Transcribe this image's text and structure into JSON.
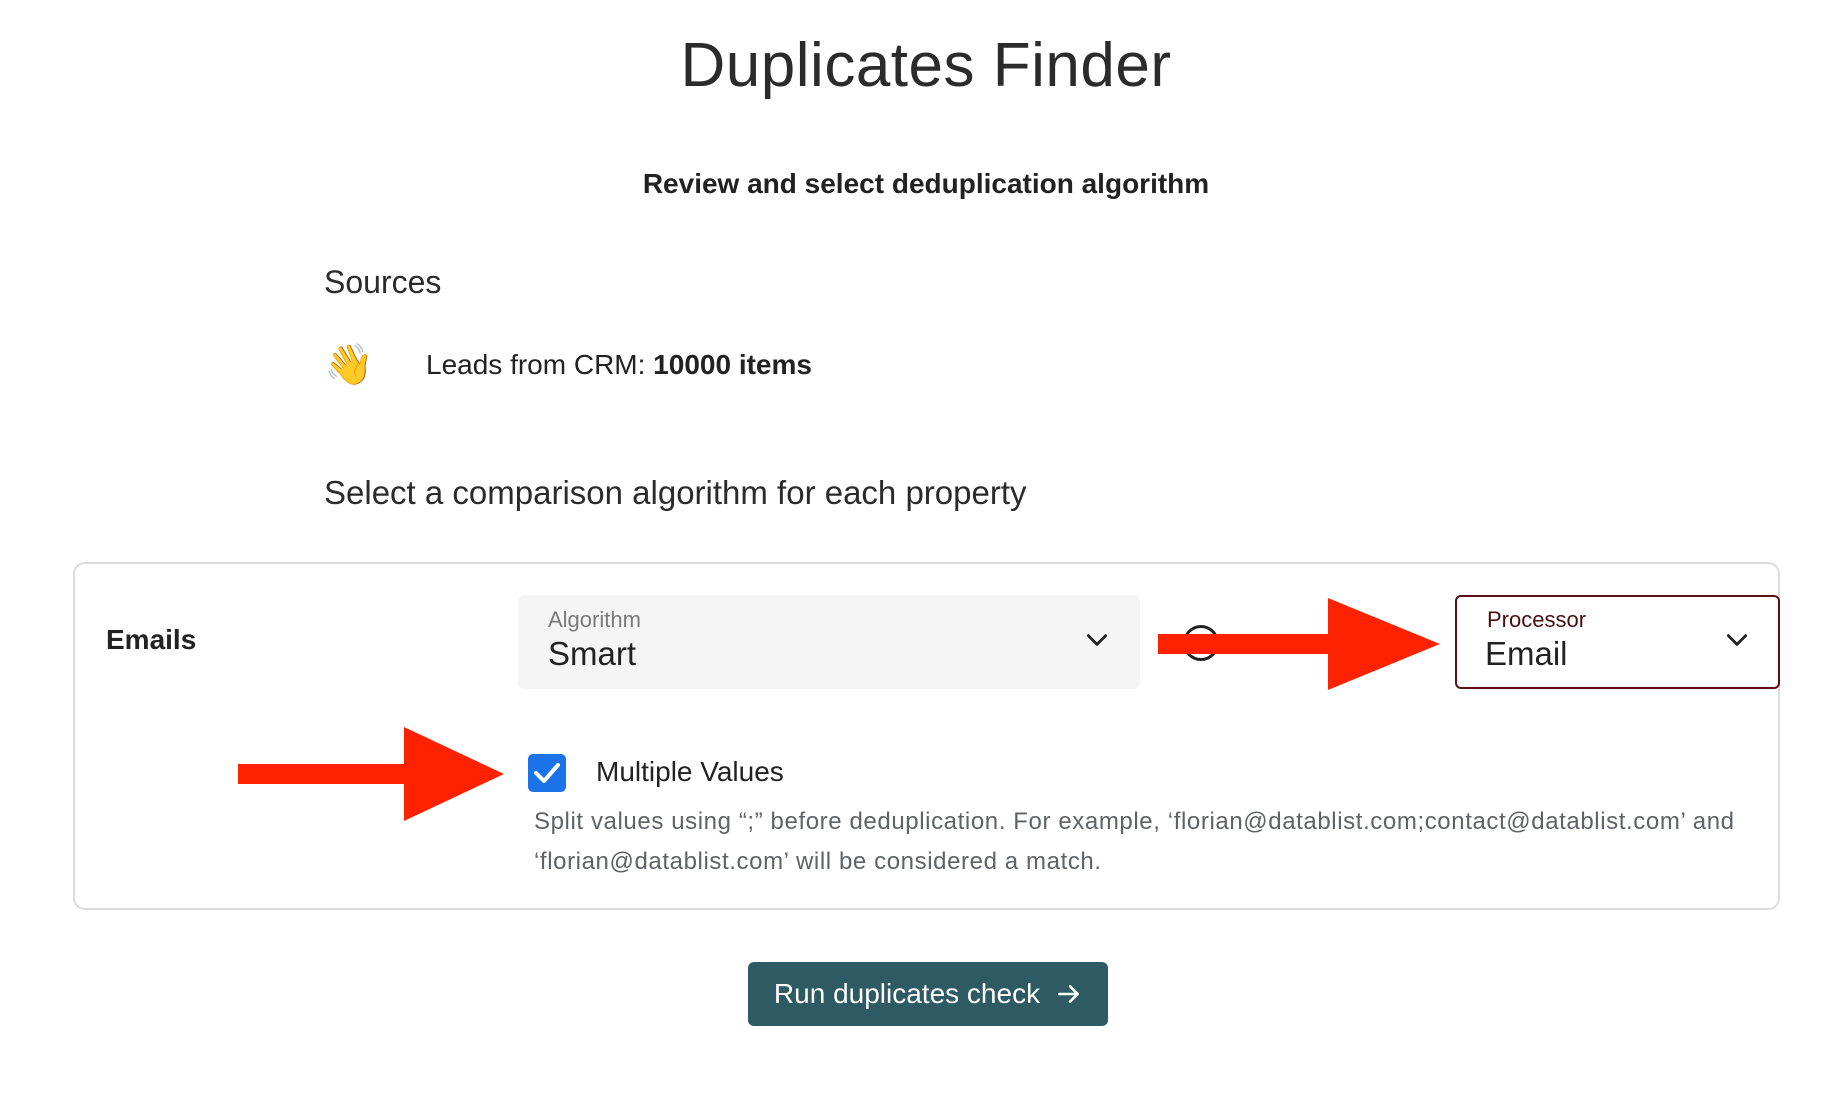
{
  "page": {
    "title": "Duplicates Finder",
    "subtitle": "Review and select deduplication algorithm"
  },
  "sources": {
    "heading": "Sources",
    "items": [
      {
        "icon": "waving-hand-icon",
        "label": "Leads from CRM: ",
        "count": "10000 items"
      }
    ]
  },
  "algorithm_section": {
    "heading": "Select a comparison algorithm for each property"
  },
  "property": {
    "name": "Emails",
    "algorithm": {
      "label": "Algorithm",
      "value": "Smart"
    },
    "help_icon": "help-icon",
    "processor": {
      "label": "Processor",
      "value": "Email"
    },
    "multiple_values": {
      "checked": true,
      "label": "Multiple Values",
      "help": "Split values using “;” before deduplication. For example, ‘florian@datablist.com;contact@datablist.com’ and ‘florian@datablist.com’ will be considered a match."
    }
  },
  "actions": {
    "run_label": "Run duplicates check"
  },
  "colors": {
    "button_bg": "#2e5b63",
    "checkbox": "#1a73e8",
    "processor_border": "#5c0f12",
    "annotation_arrow": "#ff2200"
  }
}
